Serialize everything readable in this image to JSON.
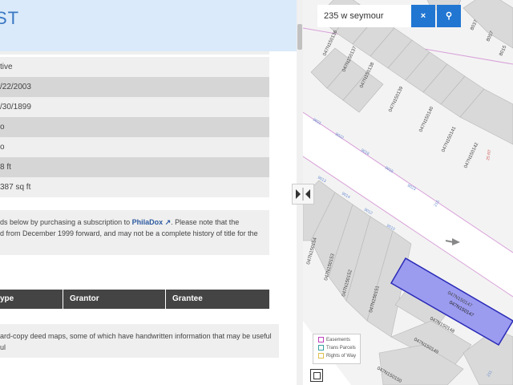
{
  "header": {
    "title": "ST"
  },
  "details": {
    "rows": [
      {
        "value": "tive"
      },
      {
        "value": "/22/2003"
      },
      {
        "value": "/30/1899"
      },
      {
        "value": "o"
      },
      {
        "value": "o"
      },
      {
        "value": "8 ft"
      },
      {
        "value": "387 sq ft"
      }
    ]
  },
  "notice": {
    "line1_pre": "ds below by purchasing a subscription to ",
    "link": "PhilaDox",
    "line1_post": ". Please note that the",
    "line2": "d from December 1999 forward, and may not be a complete history of title for the"
  },
  "deeds_table": {
    "headers": [
      "ype",
      "Grantor",
      "Grantee"
    ]
  },
  "deed_maps": {
    "line1": "ard-copy deed maps, some of which have handwritten information that may be useful",
    "line2": "ul"
  },
  "search": {
    "value": "235 w seymour",
    "clear_label": "×",
    "submit_label": "🔍"
  },
  "map": {
    "labels": [
      "047N150136",
      "047N150137",
      "047N150138",
      "047N150139",
      "047N150140",
      "047N150141",
      "047N150142",
      "047N150154",
      "047N150153",
      "047N150152",
      "047N150151",
      "047N150147",
      "047N150148",
      "047N150149",
      "047N150150",
      "8037",
      "8057",
      "8015",
      "9021",
      "9022",
      "9023",
      "9016",
      "9015",
      "9013",
      "9014",
      "9012",
      "9010",
      "211",
      "215",
      "25 RT"
    ],
    "selected_parcel": "047N150147",
    "selected_fill": "#9b9bf0",
    "selected_stroke": "#2a2ab8"
  },
  "legend": {
    "items": [
      {
        "label": "Easements",
        "color": "#c040c0"
      },
      {
        "label": "Trans Parcels",
        "color": "#3aa0a0"
      },
      {
        "label": "Rights of Way",
        "color": "#e0c050"
      }
    ]
  }
}
